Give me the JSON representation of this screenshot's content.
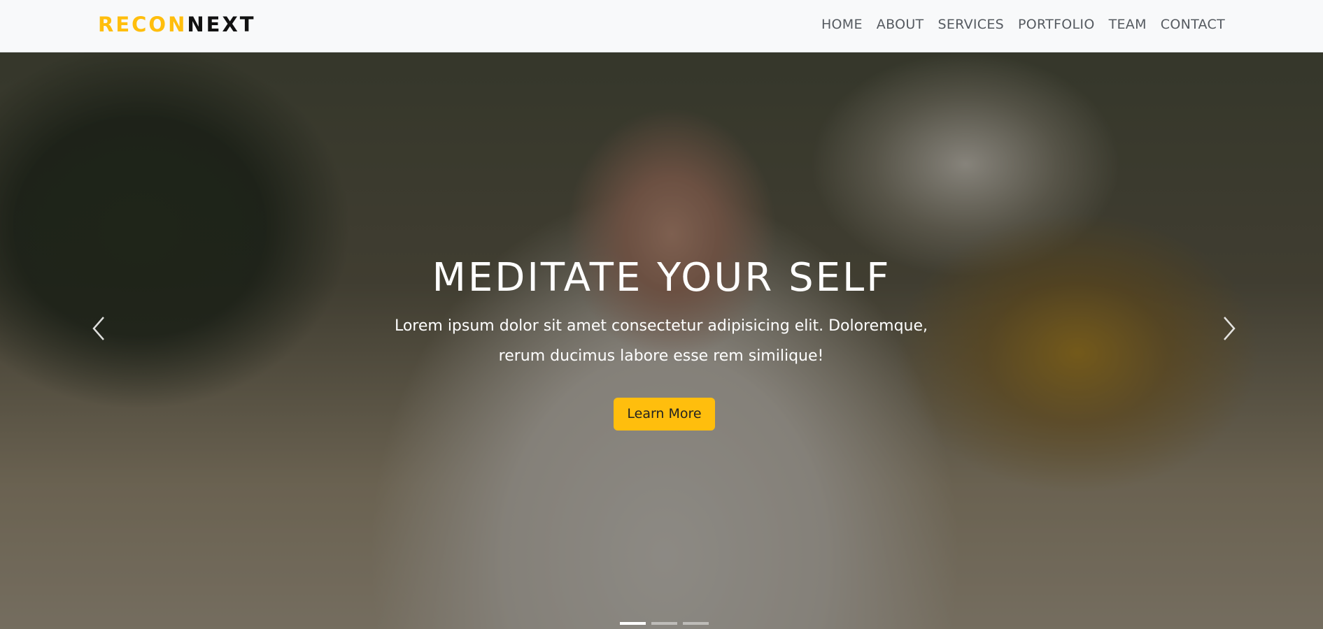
{
  "brand": {
    "accent": "RECON",
    "main": "NEXT"
  },
  "nav": {
    "items": [
      {
        "label": "HOME"
      },
      {
        "label": "ABOUT"
      },
      {
        "label": "SERVICES"
      },
      {
        "label": "PORTFOLIO"
      },
      {
        "label": "TEAM"
      },
      {
        "label": "CONTACT"
      }
    ]
  },
  "hero": {
    "title": "MEDITATE YOUR SELF",
    "text": "Lorem ipsum dolor sit amet consectetur adipisicing elit. Doloremque, rerum ducimus labore esse rem similique!",
    "button_label": "Learn More"
  },
  "carousel": {
    "prev_icon": "chevron-left-icon",
    "next_icon": "chevron-right-icon",
    "slide_count": 3,
    "active_slide": 1
  },
  "colors": {
    "accent": "#ffbe0d",
    "navbar_bg": "#f8f9fa",
    "nav_text": "#555a60"
  }
}
